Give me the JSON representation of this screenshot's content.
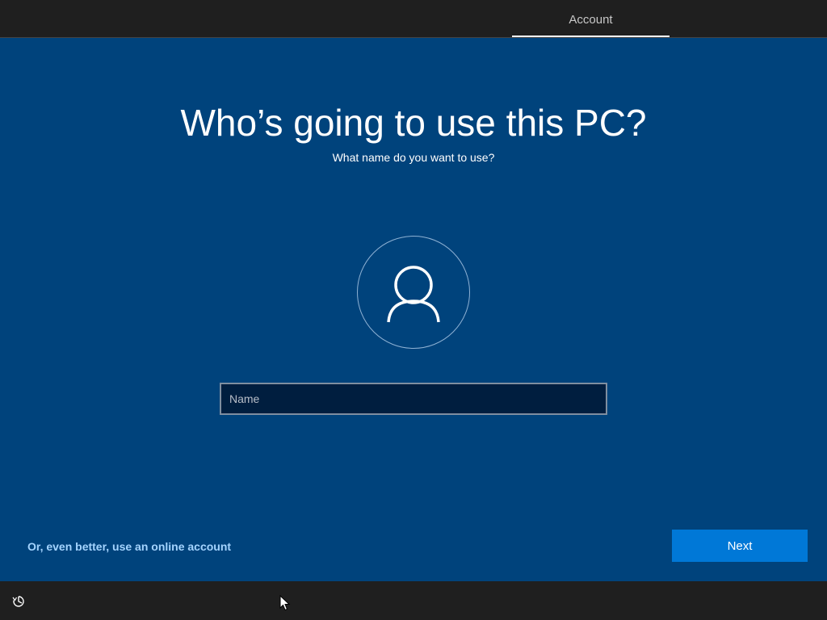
{
  "header": {
    "tab_label": "Account"
  },
  "main": {
    "title": "Who’s going to use this PC?",
    "subtitle": "What name do you want to use?",
    "avatar_icon": "user-icon",
    "name_input": {
      "value": "",
      "placeholder": "Name"
    }
  },
  "footer": {
    "online_account_link": "Or, even better, use an online account",
    "next_label": "Next"
  },
  "taskbar": {
    "accessibility_icon": "ease-of-access-icon",
    "cursor_icon": "mouse-pointer-icon"
  },
  "colors": {
    "background": "#00437c",
    "bar": "#1f1f1f",
    "accent": "#0078d7",
    "link": "#a4d4ff"
  }
}
